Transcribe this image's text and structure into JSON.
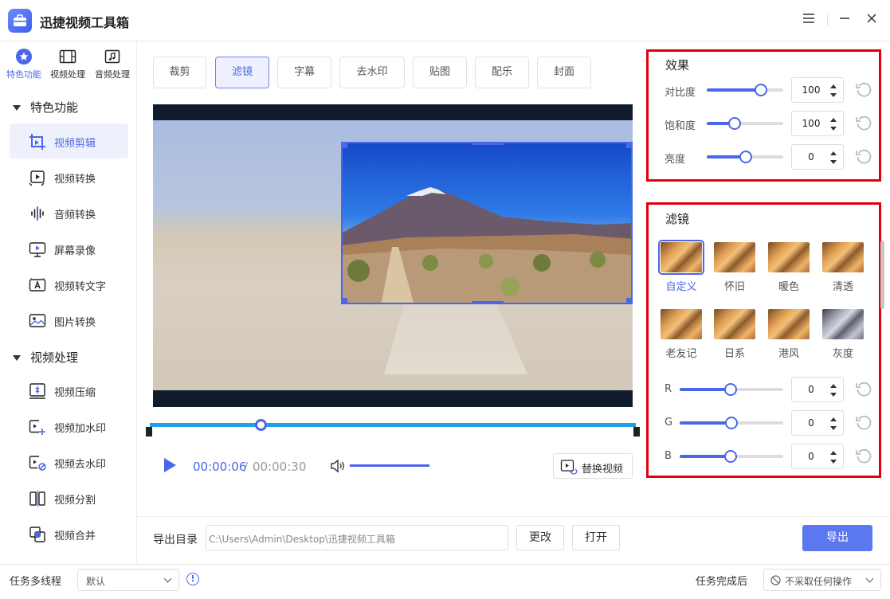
{
  "app": {
    "title": "迅捷视频工具箱"
  },
  "sidebar": {
    "top_categories": [
      {
        "label": "特色功能",
        "icon": "star-icon"
      },
      {
        "label": "视频处理",
        "icon": "film-icon"
      },
      {
        "label": "音频处理",
        "icon": "music-note-icon"
      }
    ],
    "sections": [
      {
        "label": "特色功能",
        "items": [
          {
            "label": "视频剪辑",
            "icon": "video-crop-icon"
          },
          {
            "label": "视频转换",
            "icon": "video-convert-icon"
          },
          {
            "label": "音频转换",
            "icon": "audio-wave-icon"
          },
          {
            "label": "屏幕录像",
            "icon": "screen-record-icon"
          },
          {
            "label": "视频转文字",
            "icon": "video-to-text-icon"
          },
          {
            "label": "图片转换",
            "icon": "image-convert-icon"
          }
        ]
      },
      {
        "label": "视频处理",
        "items": [
          {
            "label": "视频压缩",
            "icon": "compress-icon"
          },
          {
            "label": "视频加水印",
            "icon": "add-watermark-icon"
          },
          {
            "label": "视频去水印",
            "icon": "remove-watermark-icon"
          },
          {
            "label": "视频分割",
            "icon": "split-icon"
          },
          {
            "label": "视频合并",
            "icon": "merge-icon"
          }
        ]
      }
    ]
  },
  "tabs": [
    "裁剪",
    "滤镜",
    "字幕",
    "去水印",
    "贴图",
    "配乐",
    "封面"
  ],
  "player": {
    "current_time": "00:00:06",
    "separator": "/",
    "total_time": "00:00:30",
    "progress": 0.2,
    "volume": 1.0,
    "replace_label": "替换视频"
  },
  "effects": {
    "title": "效果",
    "sliders": [
      {
        "label": "对比度",
        "value": "100",
        "level": 0.75
      },
      {
        "label": "饱和度",
        "value": "100",
        "level": 0.37
      },
      {
        "label": "亮度",
        "value": "0",
        "level": 0.53
      }
    ]
  },
  "filters": {
    "title": "滤镜",
    "items": [
      "自定义",
      "怀旧",
      "暖色",
      "清透",
      "老友记",
      "日系",
      "港风",
      "灰度"
    ],
    "selected": "自定义",
    "rgb": [
      {
        "label": "R",
        "value": "0",
        "level": 0.5
      },
      {
        "label": "G",
        "value": "0",
        "level": 0.5
      },
      {
        "label": "B",
        "value": "0",
        "level": 0.5
      }
    ]
  },
  "export": {
    "label": "导出目录",
    "path": "C:\\Users\\Admin\\Desktop\\迅捷视频工具箱",
    "change_label": "更改",
    "open_label": "打开",
    "export_label": "导出"
  },
  "footer": {
    "thread_label": "任务多线程",
    "thread_value": "默认",
    "info": "!",
    "after_label": "任务完成后",
    "after_value": "不采取任何操作"
  },
  "colors": {
    "accent": "#4a67e8",
    "highlight_border": "#e00010",
    "export_button": "#5b78f0",
    "progress": "#1aa3e8"
  }
}
